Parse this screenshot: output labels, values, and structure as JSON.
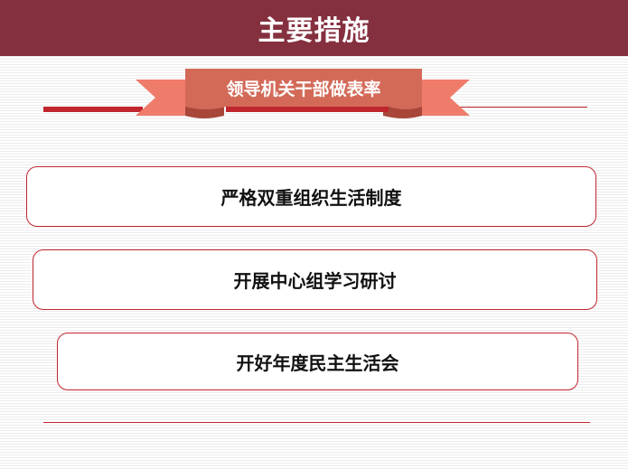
{
  "header": {
    "title": "主要措施"
  },
  "ribbon": {
    "label": "领导机关干部做表率"
  },
  "items": [
    {
      "label": "严格双重组织生活制度"
    },
    {
      "label": "开展中心组学习研讨"
    },
    {
      "label": "开好年度民主生活会"
    }
  ],
  "colors": {
    "header_bg": "#84303f",
    "ribbon_front": "#d36a58",
    "ribbon_back": "#ef7c6a",
    "accent_red": "#c0262e"
  }
}
